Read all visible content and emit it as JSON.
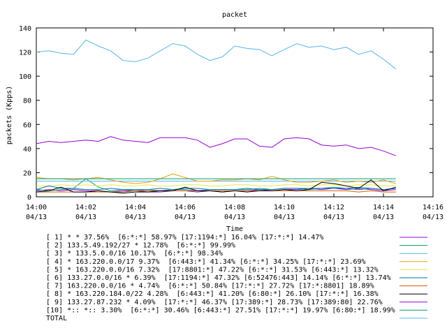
{
  "chart_data": {
    "type": "line",
    "title": "packet",
    "xlabel": "Time",
    "ylabel": "packets (Kpps)",
    "ylim": [
      0,
      140
    ],
    "yticks": [
      0,
      20,
      40,
      60,
      80,
      100,
      120,
      140
    ],
    "xlim": [
      "14:00",
      "14:16"
    ],
    "xticks": [
      {
        "time": "14:00",
        "date": "04/13"
      },
      {
        "time": "14:02",
        "date": "04/13"
      },
      {
        "time": "14:04",
        "date": "04/13"
      },
      {
        "time": "14:06",
        "date": "04/13"
      },
      {
        "time": "14:08",
        "date": "04/13"
      },
      {
        "time": "14:10",
        "date": "04/13"
      },
      {
        "time": "14:12",
        "date": "04/13"
      },
      {
        "time": "14:14",
        "date": "04/13"
      },
      {
        "time": "14:16",
        "date": "04/13"
      }
    ],
    "grid": false,
    "legend_position": "bottom",
    "x": [
      "14:00:00",
      "14:00:30",
      "14:01:00",
      "14:01:30",
      "14:02:00",
      "14:02:30",
      "14:03:00",
      "14:03:30",
      "14:04:00",
      "14:04:30",
      "14:05:00",
      "14:05:30",
      "14:06:00",
      "14:06:30",
      "14:07:00",
      "14:07:30",
      "14:08:00",
      "14:08:30",
      "14:09:00",
      "14:09:30",
      "14:10:00",
      "14:10:30",
      "14:11:00",
      "14:11:30",
      "14:12:00",
      "14:12:30",
      "14:13:00",
      "14:13:30",
      "14:14:00",
      "14:14:30"
    ],
    "series": [
      {
        "name": "[ 1] * * 37.56%  [6:*:*] 58.97% [17:1194:*] 16.04% [17:*:*] 14.47%",
        "color": "#9400d3",
        "values": [
          5,
          6,
          5,
          6,
          5,
          5,
          4,
          5,
          5,
          4,
          4,
          5,
          5,
          4,
          5,
          4,
          5,
          5,
          6,
          5,
          6,
          6,
          7,
          6,
          7,
          6,
          7,
          6,
          5,
          6
        ]
      },
      {
        "name": "[ 2] 133.5.49.192/27 * 12.78%  [6:*:*] 99.99%",
        "color": "#009e73",
        "values": [
          6,
          5,
          6,
          7,
          15,
          8,
          5,
          6,
          5,
          6,
          5,
          6,
          6,
          5,
          6,
          6,
          6,
          6,
          7,
          6,
          7,
          7,
          7,
          7,
          8,
          7,
          8,
          7,
          6,
          7
        ]
      },
      {
        "name": "[ 3] * 133.5.0.0/16 10.17%  [6:*:*] 98.34%",
        "color": "#56b4e9",
        "values": [
          13,
          13,
          13,
          13,
          13,
          13,
          13,
          13,
          13,
          13,
          13,
          13,
          13,
          13,
          13,
          13,
          13,
          13,
          13,
          13,
          13,
          13,
          13,
          13,
          13,
          13,
          13,
          13,
          13,
          13
        ]
      },
      {
        "name": "[ 4] * 163.220.0.0/17 9.37%  [6:443:*] 41.34% [6:*:*] 34.25% [17:*:*] 23.69%",
        "color": "#e69f00",
        "values": [
          16,
          15,
          15,
          14,
          15,
          16,
          14,
          12,
          11,
          12,
          15,
          19,
          16,
          13,
          13,
          14,
          14,
          15,
          14,
          17,
          14,
          12,
          12,
          13,
          14,
          12,
          13,
          12,
          14,
          11
        ]
      },
      {
        "name": "[ 5] * 163.220.0.0/16 7.32%  [17:8801:*] 47.22% [6:*:*] 31.53% [6:443:*] 13.32%",
        "color": "#f0e442",
        "values": [
          9,
          9,
          10,
          9,
          10,
          9,
          10,
          9,
          9,
          10,
          9,
          9,
          10,
          10,
          9,
          9,
          10,
          10,
          9,
          9,
          10,
          10,
          9,
          10,
          10,
          9,
          10,
          10,
          9,
          9
        ]
      },
      {
        "name": "[ 6] 133.27.0.0/16 * 6.39%  [17:1194:*] 47.32% [6:52476:443] 14.14% [6:*:*] 13.74%",
        "color": "#0072b2",
        "values": [
          6,
          9,
          7,
          7,
          6,
          6,
          7,
          6,
          6,
          6,
          7,
          6,
          7,
          7,
          6,
          6,
          6,
          7,
          6,
          6,
          7,
          7,
          6,
          7,
          7,
          7,
          6,
          7,
          6,
          7
        ]
      },
      {
        "name": "[ 7] 163.220.0.0/16 * 4.74%  [6:*:*] 50.84% [17:*:*] 27.72% [17:*:8801] 18.89%",
        "color": "#d55e00",
        "values": [
          4,
          4,
          4,
          4,
          4,
          4,
          4,
          4,
          5,
          5,
          5,
          5,
          5,
          5,
          5,
          5,
          5,
          5,
          5,
          5,
          5,
          5,
          5,
          5,
          5,
          5,
          4,
          5,
          4,
          4
        ]
      },
      {
        "name": "[ 8] * 163.220.184.0/22 4.28%  [6:443:*] 41.20% [6:80:*] 26.10% [17:*:*] 16.38%",
        "color": "#000000",
        "values": [
          4,
          5,
          8,
          4,
          4,
          5,
          4,
          3,
          4,
          4,
          5,
          5,
          8,
          5,
          5,
          4,
          5,
          4,
          5,
          5,
          6,
          5,
          6,
          12,
          11,
          9,
          7,
          14,
          5,
          8
        ]
      },
      {
        "name": "[ 9] 133.27.87.232 * 4.09%  [17:*:*] 46.37% [17:389:*] 28.73% [17:389:80] 22.76%",
        "color": "#9400d3",
        "values": [
          44,
          46,
          45,
          46,
          47,
          46,
          50,
          47,
          46,
          45,
          49,
          49,
          49,
          47,
          41,
          44,
          48,
          48,
          42,
          41,
          48,
          49,
          48,
          43,
          42,
          43,
          40,
          41,
          38,
          34
        ]
      },
      {
        "name": "[10] *:: *:: 3.30%  [6:*:*] 30.46% [6:443:*] 27.51% [17:*:*] 19.97% [6:80:*] 18.99%",
        "color": "#009e73",
        "values": [
          15,
          15,
          15,
          15,
          15,
          15,
          15,
          15,
          15,
          15,
          15,
          15,
          15,
          15,
          15,
          15,
          15,
          15,
          15,
          15,
          15,
          15,
          15,
          15,
          15,
          15,
          15,
          15,
          15,
          15
        ]
      },
      {
        "name": "TOTAL",
        "color": "#56b4e9",
        "values": [
          120,
          121,
          119,
          118,
          130,
          125,
          121,
          113,
          112,
          115,
          121,
          127,
          125,
          118,
          113,
          116,
          125,
          123,
          122,
          117,
          122,
          127,
          124,
          125,
          122,
          124,
          118,
          121,
          114,
          106
        ]
      }
    ]
  }
}
